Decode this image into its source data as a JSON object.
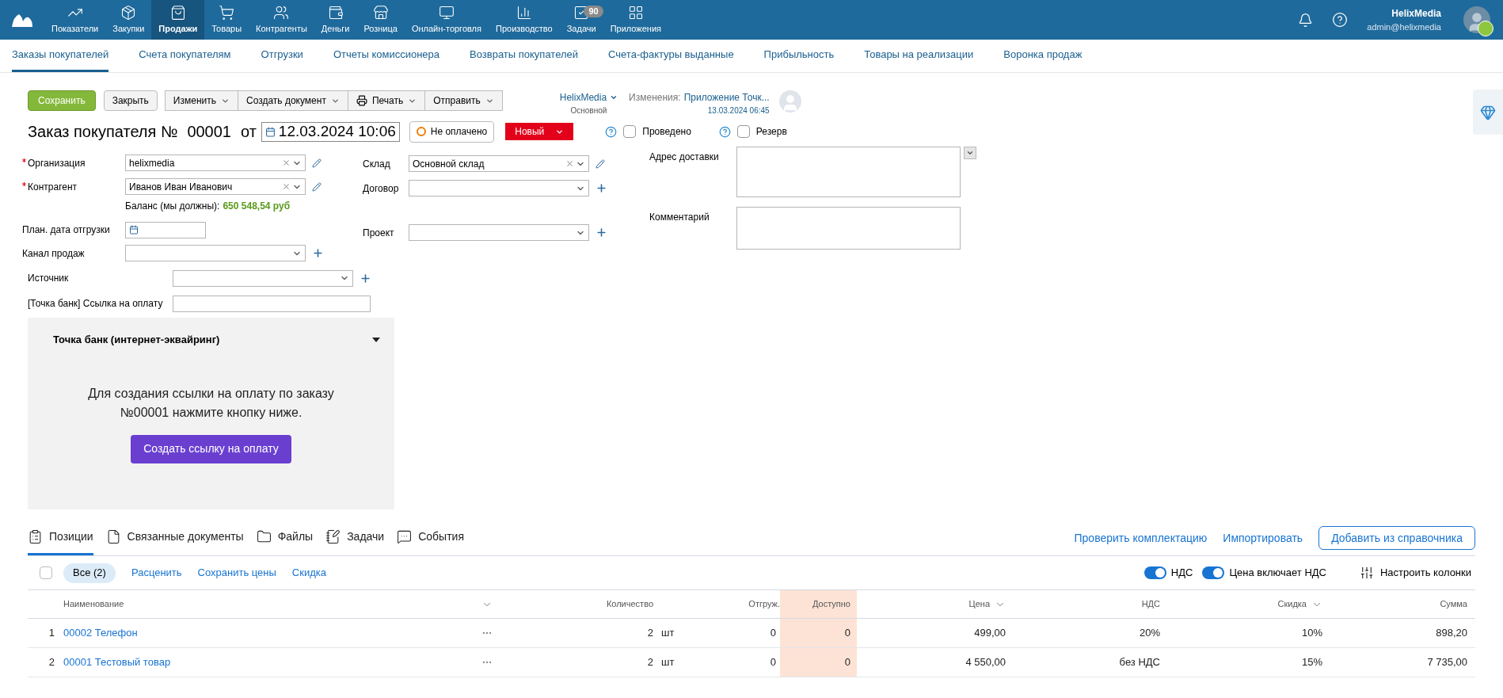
{
  "nav": {
    "items": [
      {
        "label": "Показатели",
        "selected": false
      },
      {
        "label": "Закупки",
        "selected": false
      },
      {
        "label": "Продажи",
        "selected": true
      },
      {
        "label": "Товары",
        "selected": false
      },
      {
        "label": "Контрагенты",
        "selected": false
      },
      {
        "label": "Деньги",
        "selected": false
      },
      {
        "label": "Розница",
        "selected": false
      },
      {
        "label": "Онлайн-торговля",
        "selected": false
      },
      {
        "label": "Производство",
        "selected": false
      },
      {
        "label": "Задачи",
        "selected": false,
        "badge": "90"
      },
      {
        "label": "Приложения",
        "selected": false
      }
    ],
    "user": {
      "name": "HelixMedia",
      "email": "admin@helixmedia"
    }
  },
  "subnav": [
    {
      "label": "Заказы покупателей",
      "selected": true
    },
    {
      "label": "Счета покупателям",
      "selected": false
    },
    {
      "label": "Отгрузки",
      "selected": false
    },
    {
      "label": "Отчеты комиссионера",
      "selected": false
    },
    {
      "label": "Возвраты покупателей",
      "selected": false
    },
    {
      "label": "Счета-фактуры выданные",
      "selected": false
    },
    {
      "label": "Прибыльность",
      "selected": false
    },
    {
      "label": "Товары на реализации",
      "selected": false
    },
    {
      "label": "Воронка продаж",
      "selected": false
    }
  ],
  "toolbar": {
    "save": "Сохранить",
    "close": "Закрыть",
    "menus": [
      {
        "label": "Изменить",
        "kind": "menu"
      },
      {
        "label": "Создать документ",
        "kind": "menu"
      },
      {
        "label": "Печать",
        "kind": "print"
      },
      {
        "label": "Отправить",
        "kind": "menu"
      }
    ],
    "owner": {
      "name": "HelixMedia",
      "group": "Основной"
    },
    "changes": {
      "label": "Изменения:",
      "link": "Приложение Точк...",
      "date": "13.03.2024 06:45"
    }
  },
  "header": {
    "title": "Заказ покупателя №",
    "number": "00001",
    "from": "от",
    "date": "12.03.2024 10:06",
    "payment": "Не оплачено",
    "status": "Новый",
    "checks": [
      {
        "label": "Проведено",
        "checked": false
      },
      {
        "label": "Резерв",
        "checked": false
      }
    ]
  },
  "form": {
    "left": [
      {
        "label": "Организация",
        "required": true,
        "kind": "select",
        "value": "helixmedia",
        "clear": true,
        "edit": true,
        "add": false
      },
      {
        "label": "Контрагент",
        "required": true,
        "kind": "select",
        "value": "Иванов Иван Иванович",
        "clear": true,
        "edit": true,
        "add": false
      },
      {
        "label": "Баланс (мы должны):",
        "kind": "balance",
        "value": "650 548,54 руб"
      },
      {
        "label": "План. дата отгрузки",
        "required": false,
        "kind": "date",
        "edit": false,
        "add": false
      },
      {
        "label": "Канал продаж",
        "required": false,
        "kind": "select",
        "clear": false,
        "edit": false,
        "add": true
      }
    ],
    "middle": [
      {
        "label": "Склад",
        "required": false,
        "kind": "select",
        "value": "Основной склад",
        "clear": true,
        "edit": true,
        "add": false
      },
      {
        "label": "Договор",
        "required": false,
        "kind": "select",
        "clear": false,
        "edit": false,
        "add": true
      },
      {
        "label": "Проект",
        "required": false,
        "kind": "select",
        "clear": false,
        "edit": false,
        "add": true
      }
    ],
    "right": [
      {
        "label": "Адрес доставки",
        "kind": "address"
      },
      {
        "label": "Комментарий",
        "kind": "comment"
      }
    ],
    "extra": [
      {
        "label": "Источник",
        "required": false,
        "kind": "select",
        "clear": false,
        "edit": false,
        "add": true
      },
      {
        "label": "[Точка банк] Ссылка на оплату",
        "required": false,
        "kind": "text",
        "edit": false,
        "add": false
      }
    ]
  },
  "bank": {
    "title": "Точка банк (интернет-эквайринг)",
    "expanded": true,
    "text": "Для создания ссылки на оплату по заказу №00001 нажмите кнопку ниже.",
    "button": "Создать ссылку на оплату"
  },
  "tabs": [
    {
      "label": "Позиции",
      "selected": true
    },
    {
      "label": "Связанные документы",
      "selected": false
    },
    {
      "label": "Файлы",
      "selected": false
    },
    {
      "label": "Задачи",
      "selected": false
    },
    {
      "label": "События",
      "selected": false
    }
  ],
  "tab_actions": {
    "links": [
      "Проверить комплектацию",
      "Импортировать"
    ],
    "button": "Добавить из справочника"
  },
  "table_toolbar": {
    "select_all": false,
    "filter": {
      "label": "Все (2)",
      "selected": true
    },
    "links": [
      "Расценить",
      "Сохранить цены",
      "Скидка"
    ],
    "toggles": [
      {
        "label": "НДС",
        "on": true
      },
      {
        "label": "Цена включает НДС",
        "on": true
      }
    ],
    "configure": "Настроить колонки"
  },
  "table": {
    "columns": [
      {
        "label": "Наименование",
        "sortable": false
      },
      {
        "label": "Количество",
        "sortable": false
      },
      {
        "label": "Отгруж.",
        "sortable": false
      },
      {
        "label": "Доступно",
        "sortable": false
      },
      {
        "label": "Цена",
        "sortable": true
      },
      {
        "label": "НДС",
        "sortable": false
      },
      {
        "label": "Скидка",
        "sortable": true
      },
      {
        "label": "Сумма",
        "sortable": false
      }
    ],
    "rows": [
      {
        "num": "1",
        "name": "00002 Телефон",
        "qty": "2",
        "unit": "шт",
        "shipped": "0",
        "available": "0",
        "price": "499,00",
        "vat": "20%",
        "discount": "10%",
        "sum": "898,20"
      },
      {
        "num": "2",
        "name": "00001 Тестовый товар",
        "qty": "2",
        "unit": "шт",
        "shipped": "0",
        "available": "0",
        "price": "4 550,00",
        "vat": "без НДС",
        "discount": "15%",
        "sum": "7 735,00"
      }
    ]
  }
}
